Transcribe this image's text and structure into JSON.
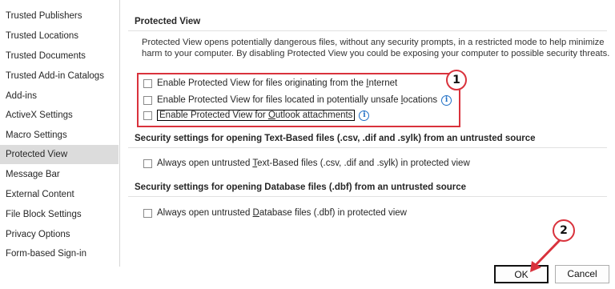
{
  "sidebar": {
    "items": [
      {
        "label": "Trusted Publishers"
      },
      {
        "label": "Trusted Locations"
      },
      {
        "label": "Trusted Documents"
      },
      {
        "label": "Trusted Add-in Catalogs"
      },
      {
        "label": "Add-ins"
      },
      {
        "label": "ActiveX Settings"
      },
      {
        "label": "Macro Settings"
      },
      {
        "label": "Protected View"
      },
      {
        "label": "Message Bar"
      },
      {
        "label": "External Content"
      },
      {
        "label": "File Block Settings"
      },
      {
        "label": "Privacy Options"
      },
      {
        "label": "Form-based Sign-in"
      }
    ],
    "selected": "Protected View"
  },
  "protected_view": {
    "title": "Protected View",
    "description": "Protected View opens potentially dangerous files, without any security prompts, in a restricted mode to help minimize harm to your computer. By disabling Protected View you could be exposing your computer to possible security threats.",
    "options": [
      {
        "pre": "Enable Protected View for files originating from the ",
        "accel": "I",
        "post": "nternet",
        "checked": false
      },
      {
        "pre": "Enable Protected View for files located in potentially unsafe ",
        "accel": "l",
        "post": "ocations",
        "checked": false
      },
      {
        "pre": "Enable Protected View for ",
        "accel": "O",
        "post": "utlook attachments",
        "checked": false
      }
    ]
  },
  "text_files": {
    "title": "Security settings for opening Text-Based files (.csv, .dif and .sylk) from an untrusted source",
    "option": {
      "pre": "Always open untrusted ",
      "accel": "T",
      "post": "ext-Based files (.csv, .dif and .sylk) in protected view",
      "checked": false
    }
  },
  "database_files": {
    "title": "Security settings for opening Database files (.dbf) from an untrusted source",
    "option": {
      "pre": "Always open untrusted ",
      "accel": "D",
      "post": "atabase files (.dbf) in protected view",
      "checked": false
    }
  },
  "buttons": {
    "ok": "OK",
    "cancel": "Cancel"
  },
  "annotations": {
    "badge1": "1",
    "badge2": "2",
    "color": "#d9323c"
  },
  "icons": {
    "info": "info-icon"
  }
}
